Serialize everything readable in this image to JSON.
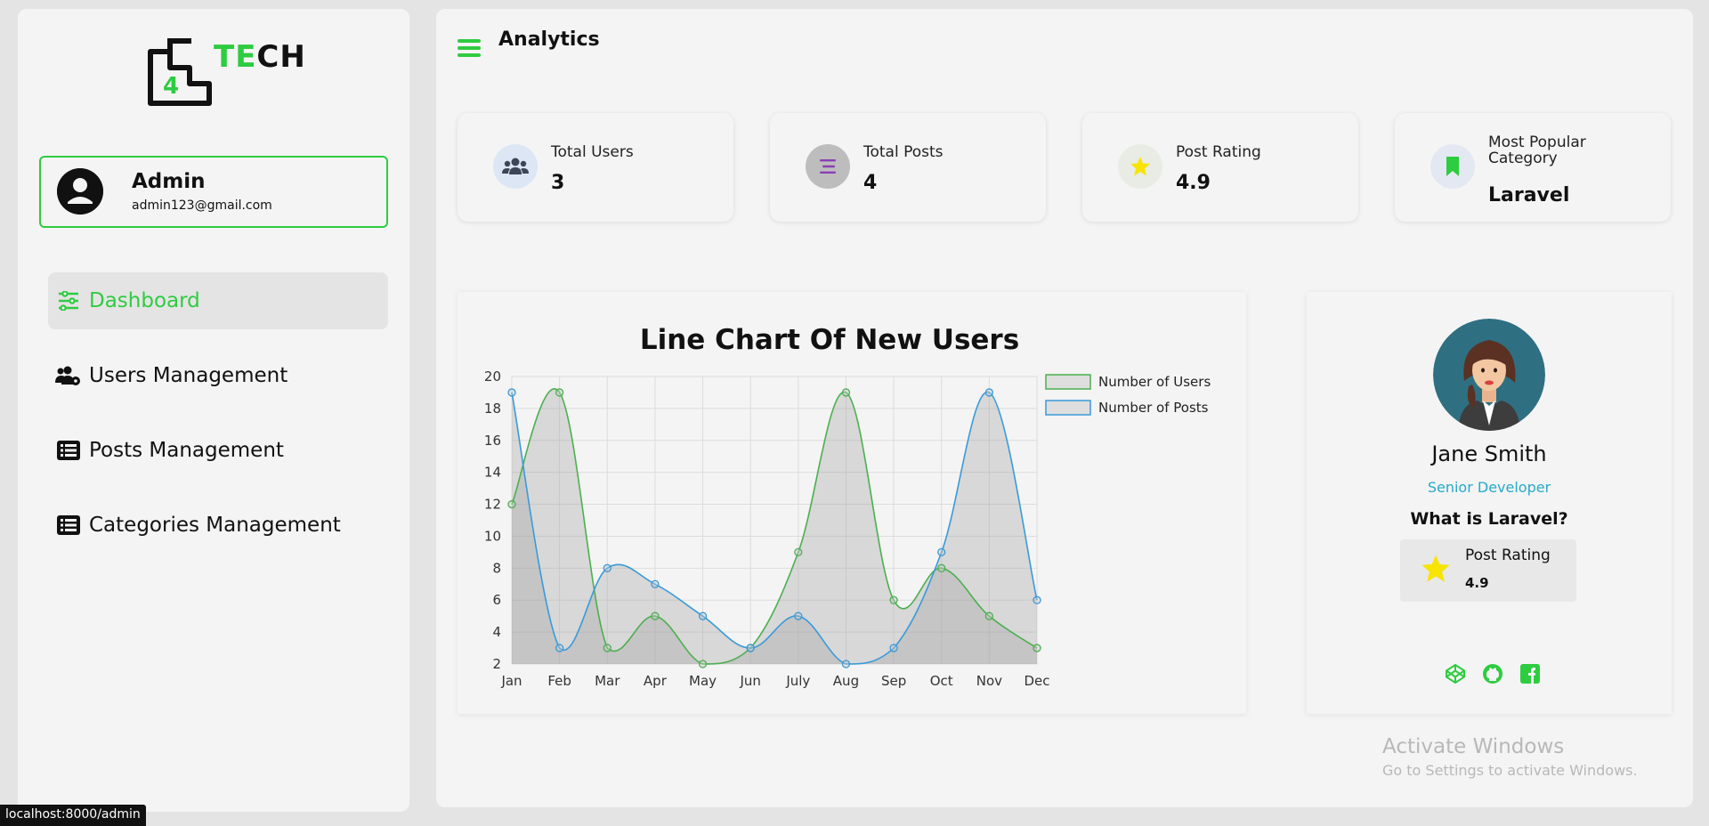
{
  "brand": {
    "logo_text": "TECH",
    "logo_number": "4",
    "accent": "#2ecc40"
  },
  "admin": {
    "name": "Admin",
    "email": "admin123@gmail.com"
  },
  "sidebar": {
    "items": [
      {
        "label": "Dashboard",
        "icon": "sliders-icon",
        "active": true
      },
      {
        "label": "Users Management",
        "icon": "users-gear-icon"
      },
      {
        "label": "Posts Management",
        "icon": "list-icon"
      },
      {
        "label": "Categories Management",
        "icon": "list-icon"
      }
    ]
  },
  "header": {
    "title": "Analytics"
  },
  "stats": [
    {
      "label": "Total Users",
      "value": "3",
      "icon": "users-icon"
    },
    {
      "label": "Total Posts",
      "value": "4",
      "icon": "bars-icon"
    },
    {
      "label": "Post Rating",
      "value": "4.9",
      "icon": "star-icon"
    },
    {
      "label": "Most Popular Category",
      "value": "Laravel",
      "icon": "bookmark-icon"
    }
  ],
  "chart_data": {
    "type": "line",
    "title": "Line Chart Of New Users",
    "categories": [
      "Jan",
      "Feb",
      "Mar",
      "Apr",
      "May",
      "Jun",
      "July",
      "Aug",
      "Sep",
      "Oct",
      "Nov",
      "Dec"
    ],
    "series": [
      {
        "name": "Number of Users",
        "color": "#4caf50",
        "values": [
          12,
          19,
          3,
          5,
          2,
          3,
          9,
          19,
          6,
          8,
          5,
          3
        ]
      },
      {
        "name": "Number of Posts",
        "color": "#3a9ad9",
        "values": [
          19,
          3,
          8,
          7,
          5,
          3,
          5,
          2,
          3,
          9,
          19,
          6
        ]
      }
    ],
    "ylim": [
      2,
      20
    ],
    "yticks": [
      2,
      4,
      6,
      8,
      10,
      12,
      14,
      16,
      18,
      20
    ],
    "grid": true,
    "legend": "top-right"
  },
  "profile": {
    "name": "Jane Smith",
    "role": "Senior Developer",
    "question": "What is Laravel?",
    "rating_label": "Post Rating",
    "rating_value": "4.9",
    "socials": [
      "codepen-icon",
      "github-icon",
      "facebook-icon"
    ]
  },
  "watermark": {
    "line1": "Activate Windows",
    "line2": "Go to Settings to activate Windows."
  },
  "status_url": "localhost:8000/admin"
}
